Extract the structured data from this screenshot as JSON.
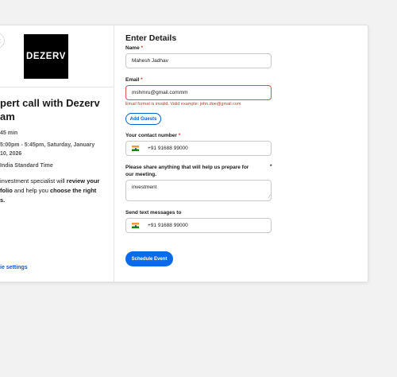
{
  "left": {
    "back_icon": "chevron-left-icon",
    "logo_text": "DEZERV",
    "event_title": "pert call with Dezerv am",
    "event_title_line1": "pert call with Dezerv",
    "event_title_line2": "am",
    "duration": "45 min",
    "datetime": "5:00pm - 5:45pm, Saturday, January 10, 2026",
    "timezone": "India Standard Time",
    "description_parts": {
      "p1": "investment specialist will ",
      "b1": "review your",
      "p2": "folio",
      "p3": " and help you ",
      "b2": "choose the right",
      "p4": "s."
    },
    "cookie_settings": "ie settings"
  },
  "form": {
    "title": "Enter Details",
    "name_label": "Name",
    "name_value": "Mahesh Jadhav",
    "email_label": "Email",
    "email_value": "mshmru@gmail.commm",
    "email_error": "Email format is invalid. Valid example: john.doe@gmail.com",
    "add_guests": "Add Guests",
    "contact_label": "Your contact number",
    "contact_value": "+91 91688 99000",
    "share_label": "Please share anything that will help us prepare for our meeting.",
    "share_value": "investment",
    "sms_label": "Send text messages to",
    "sms_value": "+91 91688 99000",
    "schedule_button": "Schedule Event",
    "required_marker": "*"
  },
  "colors": {
    "accent": "#0a6be8",
    "link": "#0a5dc2",
    "error": "#c0392b",
    "logo_bg": "#000000"
  }
}
